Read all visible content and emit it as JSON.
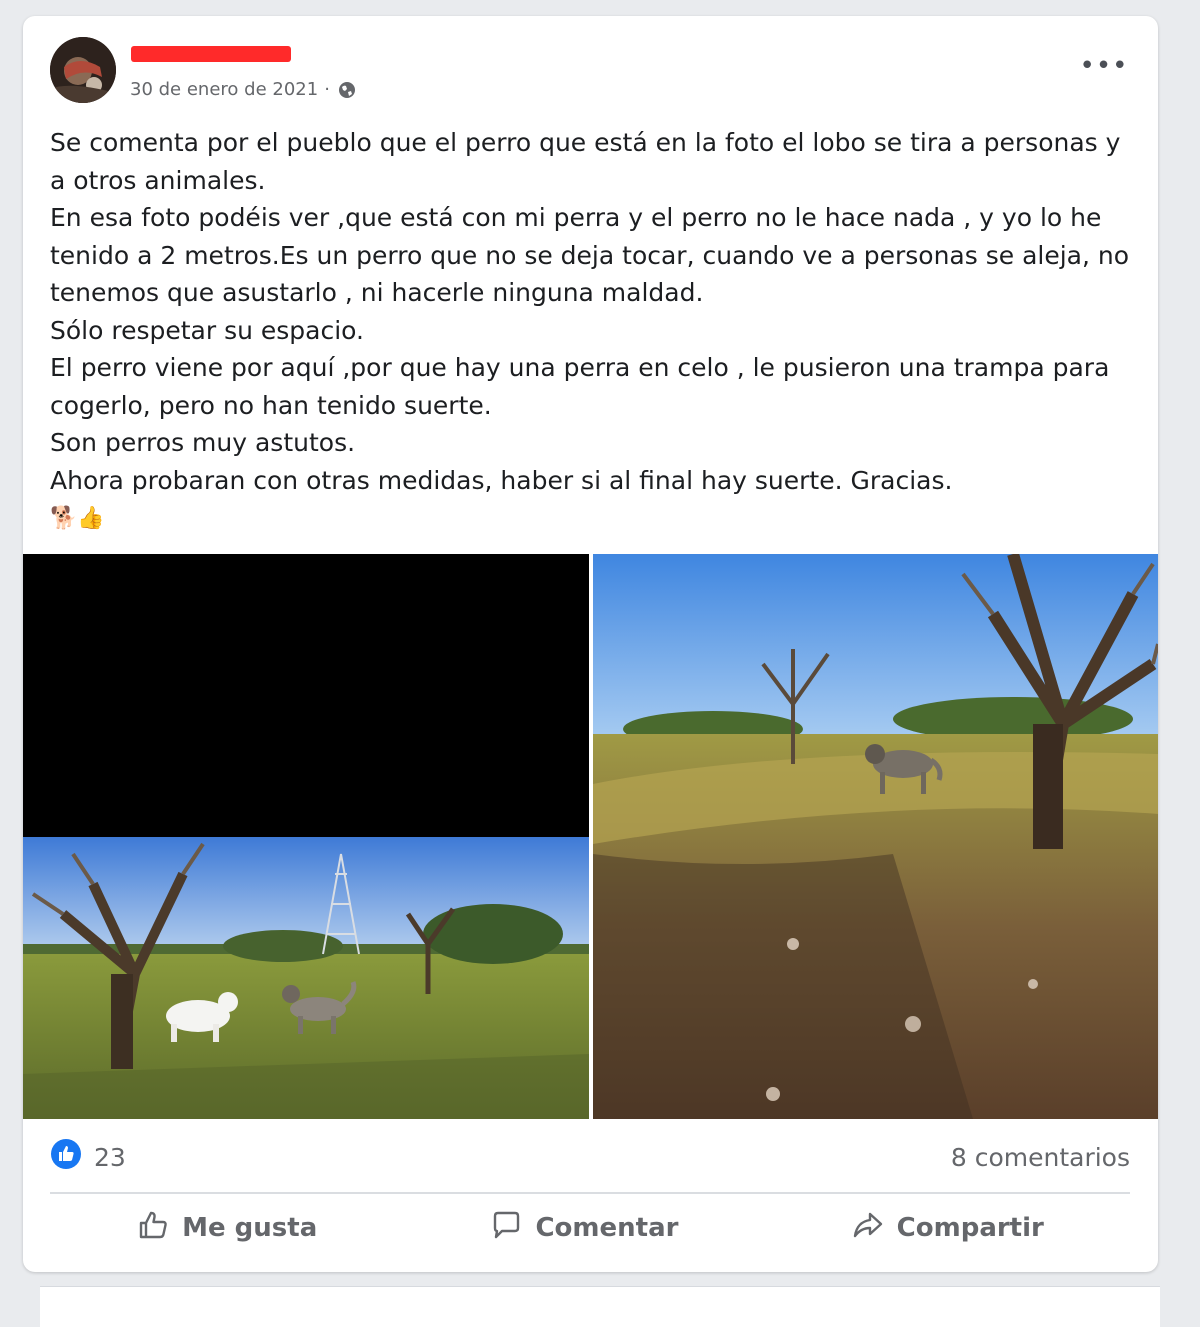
{
  "post": {
    "date": "30 de enero de 2021",
    "separator": "·",
    "more_label": "•••",
    "text_lines": [
      "Se comenta por el pueblo que el perro que está en la foto  el lobo  se tira  a personas y a otros animales.",
      "En esa foto podéis ver ,que está con mi perra  y el perro no le hace nada , y yo lo he tenido a 2 metros.Es un perro que no se deja tocar, cuando ve a personas se aleja, no tenemos que asustarlo , ni hacerle ninguna maldad.",
      "Sólo respetar su espacio.",
      "El perro viene por aquí ,por que hay una perra en celo ,  le pusieron una trampa para cogerlo,  pero no han tenido suerte.",
      "Son perros muy astutos.",
      "Ahora probaran con otras medidas, haber si al final hay suerte. Gracias."
    ],
    "emojis": "🐕👍"
  },
  "stats": {
    "likes": "23",
    "comments": "8 comentarios"
  },
  "actions": {
    "like": "Me gusta",
    "comment": "Comentar",
    "share": "Compartir"
  },
  "colors": {
    "like_blue": "#1877f2",
    "redaction": "#ff2a2a"
  }
}
